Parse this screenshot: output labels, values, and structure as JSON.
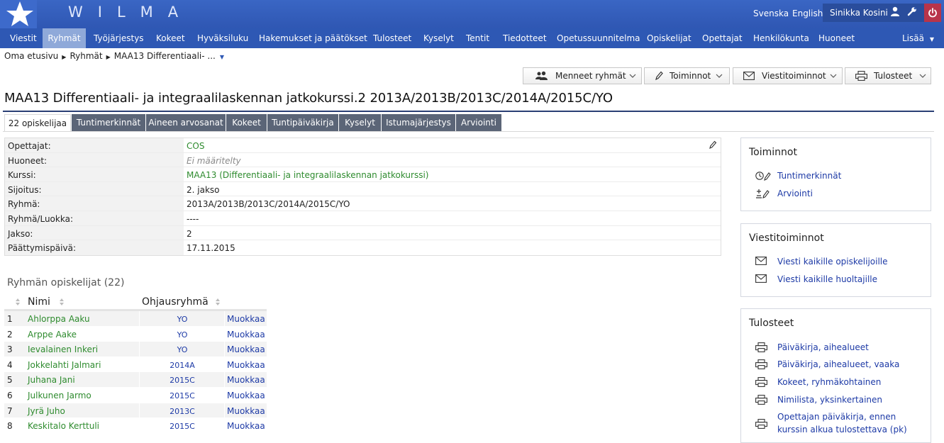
{
  "header": {
    "logo_text": "WILMA",
    "languages": [
      "Svenska",
      "English"
    ],
    "user_name": "Sinikka Kosini"
  },
  "nav": {
    "items": [
      "Viestit",
      "Ryhmät",
      "Työjärjestys",
      "Kokeet",
      "Hyväksiluku",
      "Hakemukset ja päätökset",
      "Tulosteet",
      "Kyselyt",
      "Tentit",
      "Tiedotteet",
      "Opetussuunnitelma",
      "Opiskelijat",
      "Opettajat",
      "Henkilökunta",
      "Huoneet"
    ],
    "active": "Ryhmät",
    "more_label": "Lisää"
  },
  "breadcrumb": [
    "Oma etusivu",
    "Ryhmät",
    "MAA13 Differentiaali- ..."
  ],
  "toolbar": {
    "past_groups": "Menneet ryhmät",
    "actions": "Toiminnot",
    "message_actions": "Viestitoiminnot",
    "prints": "Tulosteet"
  },
  "page_title": "MAA13 Differentiaali- ja integraalilaskennan jatkokurssi.2 2013A/2013B/2013C/2014A/2015C/YO",
  "tabs": [
    "22 opiskelijaa",
    "Tuntimerkinnät",
    "Aineen arvosanat",
    "Kokeet",
    "Tuntipäiväkirja",
    "Kyselyt",
    "Istumajärjestys",
    "Arviointi"
  ],
  "info": {
    "rows": [
      {
        "label": "Opettajat:",
        "value": "COS"
      },
      {
        "label": "Huoneet:",
        "value": "Ei määritelty"
      },
      {
        "label": "Kurssi:",
        "value": "MAA13 (Differentiaali- ja integraalilaskennan jatkokurssi)"
      },
      {
        "label": "Sijoitus:",
        "value": "2. jakso"
      },
      {
        "label": "Ryhmä:",
        "value": "2013A/2013B/2013C/2014A/2015C/YO"
      },
      {
        "label": "Ryhmä/Luokka:",
        "value": "----"
      },
      {
        "label": "Jakso:",
        "value": "2"
      },
      {
        "label": "Päättymispäivä:",
        "value": "17.11.2015"
      }
    ]
  },
  "students": {
    "heading": "Ryhmän opiskelijat (22)",
    "col_name": "Nimi",
    "col_group": "Ohjausryhmä",
    "edit_label": "Muokkaa",
    "rows": [
      {
        "num": "1",
        "name": "Ahlorppa Aaku",
        "group": "YO"
      },
      {
        "num": "2",
        "name": "Arppe Aake",
        "group": "YO"
      },
      {
        "num": "3",
        "name": "Ievalainen Inkeri",
        "group": "YO"
      },
      {
        "num": "4",
        "name": "Jokkelahti Jalmari",
        "group": "2014A"
      },
      {
        "num": "5",
        "name": "Juhana Jani",
        "group": "2015C"
      },
      {
        "num": "6",
        "name": "Julkunen Jarmo",
        "group": "2015C"
      },
      {
        "num": "7",
        "name": "Jyrä Juho",
        "group": "2013C"
      },
      {
        "num": "8",
        "name": "Keskitalo Kerttuli",
        "group": "2015C"
      }
    ]
  },
  "panels": {
    "actions": {
      "title": "Toiminnot",
      "items": [
        "Tuntimerkinnät",
        "Arviointi"
      ]
    },
    "messages": {
      "title": "Viestitoiminnot",
      "items": [
        "Viesti kaikille opiskelijoille",
        "Viesti kaikille huoltajille"
      ]
    },
    "prints": {
      "title": "Tulosteet",
      "items": [
        "Päiväkirja, aihealueet",
        "Päiväkirja, aihealueet, vaaka",
        "Kokeet, ryhmäkohtainen",
        "Nimilista, yksinkertainen",
        "Opettajan päiväkirja, ennen",
        "kurssin alkua tulostettava (pk)"
      ]
    }
  }
}
